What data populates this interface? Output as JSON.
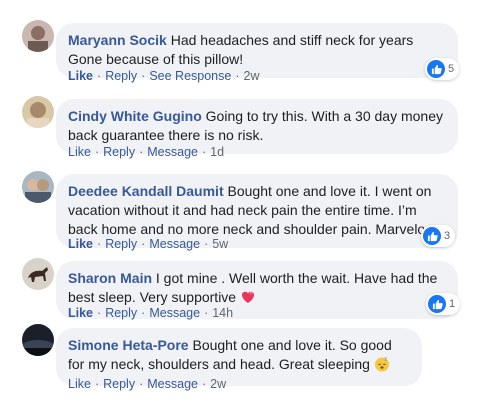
{
  "comments": [
    {
      "author": "Maryann Socik",
      "text": "Had headaches and stiff neck for years Gone because of this pillow!",
      "actions": [
        "Like",
        "Reply",
        "See Response"
      ],
      "time": "2w",
      "reactions": "5"
    },
    {
      "author": "Cindy White Gugino",
      "text": "Going to try this. With a 30 day money back guarantee there is no risk.",
      "actions": [
        "Like",
        "Reply",
        "Message"
      ],
      "time": "1d",
      "reactions": ""
    },
    {
      "author": "Deedee Kandall Daumit",
      "text": "Bought one and love it. I went on vacation without it and had neck pain the entire time. I’m back home and no more neck and shoulder pain. Marvelous",
      "actions": [
        "Like",
        "Reply",
        "Message"
      ],
      "time": "5w",
      "reactions": "3"
    },
    {
      "author": "Sharon Main",
      "text": "I got mine . Well worth the wait. Have had the best sleep. Very supportive",
      "emoji": "heart-icon",
      "actions": [
        "Like",
        "Reply",
        "Message"
      ],
      "time": "14h",
      "reactions": "1"
    },
    {
      "author": "Simone Heta-Pore",
      "text": "Bought one and love it. So good for my neck, shoulders and head. Great sleeping",
      "emoji": "sleeping-face-icon",
      "actions": [
        "Like",
        "Reply",
        "Message"
      ],
      "time": "2w",
      "reactions": ""
    }
  ],
  "colors": {
    "author": "#385898",
    "bubble": "#f0f2f5",
    "like": "#1877f2",
    "meta": "#606770"
  }
}
